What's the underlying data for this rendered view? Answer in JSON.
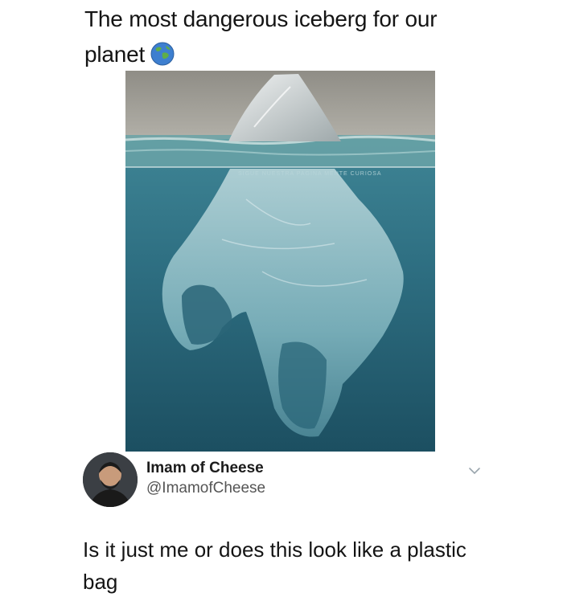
{
  "post": {
    "caption": "The most dangerous iceberg for our planet",
    "caption_emoji_icon": "globe-icon",
    "image_watermark": "SIGUE NUESTRA PAGINA MENTE CURIOSA"
  },
  "tweet": {
    "display_name": "Imam of Cheese",
    "handle": "@ImamofCheese",
    "text": "Is it just me or does this look like a plastic bag",
    "more_icon": "chevron-down-icon"
  },
  "colors": {
    "sky": "#9a9890",
    "water_surface": "#6ea7ab",
    "deep_water": "#245e70",
    "bag": "#c7dde0"
  }
}
